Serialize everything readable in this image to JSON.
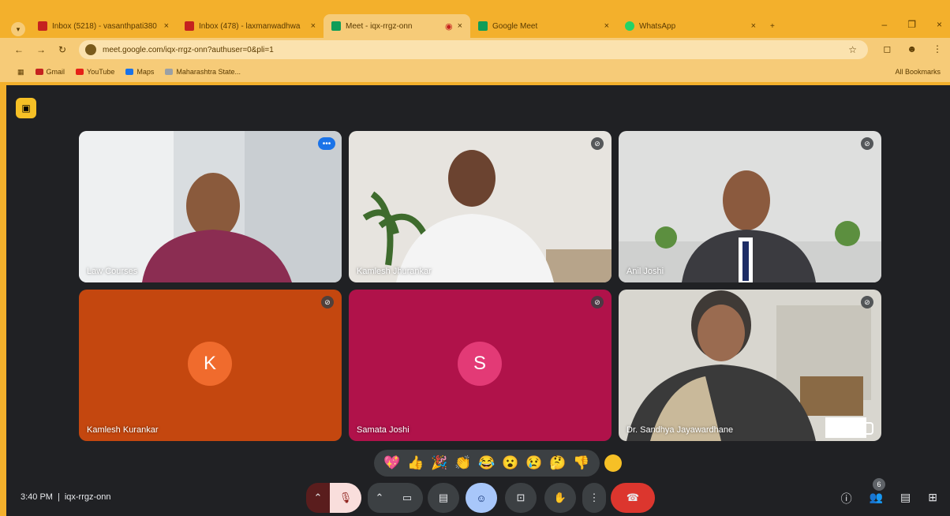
{
  "browser": {
    "tabs": [
      {
        "title": "Inbox (5218) - vasanthpati380",
        "fav_color": "#c5221f"
      },
      {
        "title": "Inbox (478) - laxmanwadhwa",
        "fav_color": "#c5221f"
      },
      {
        "title": "Meet - iqx-rrgz-onn",
        "fav_color": "#0f9d58"
      },
      {
        "title": "Google Meet",
        "fav_color": "#0f9d58"
      },
      {
        "title": "WhatsApp",
        "fav_color": "#25d366"
      }
    ],
    "url": "meet.google.com/iqx-rrgz-onn?authuser=0&pli=1",
    "bookmarks": [
      {
        "label": "Gmail",
        "color": "#c5221f"
      },
      {
        "label": "YouTube",
        "color": "#e62117"
      },
      {
        "label": "Maps",
        "color": "#1a73e8"
      },
      {
        "label": "Maharashtra State...",
        "color": "#9aa0a6"
      }
    ],
    "all_bookmarks": "All Bookmarks"
  },
  "meet": {
    "participants": [
      {
        "name": "Law Courses",
        "bg": "#d9dde0",
        "speaking": true
      },
      {
        "name": "Kamlesh Jhurankar",
        "bg": "#e7e4df"
      },
      {
        "name": "Anil Joshi",
        "bg": "#dedfde"
      },
      {
        "name": "Kamlesh Kurankar",
        "bg": "#c4470f",
        "initial": "K",
        "avatar_color": "#f06b2d"
      },
      {
        "name": "Samata Joshi",
        "bg": "#b0124a",
        "initial": "S",
        "avatar_color": "#e33a76"
      },
      {
        "name": "Dr. Sandhya Jayawardhane",
        "bg": "#d8d6cf"
      }
    ],
    "reactions": [
      "💖",
      "👍",
      "🎉",
      "👏",
      "😂",
      "😮",
      "😢",
      "🤔",
      "👎"
    ],
    "time": "3:40 PM",
    "meeting_code": "iqx-rrgz-onn",
    "people_count": "6"
  }
}
